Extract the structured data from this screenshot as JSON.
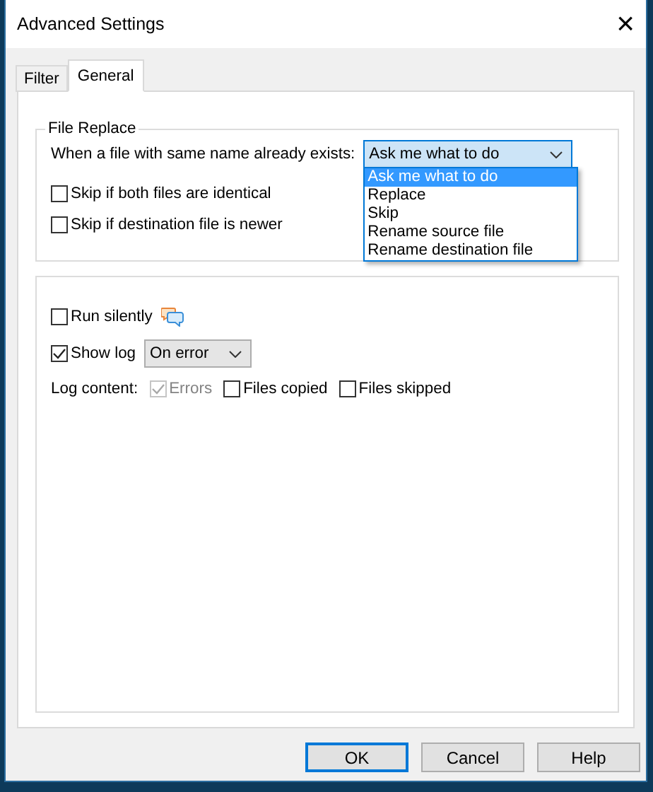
{
  "window": {
    "title": "Advanced Settings",
    "close": "×"
  },
  "tabs": [
    {
      "label": "Filter",
      "selected": false
    },
    {
      "label": "General",
      "selected": true
    }
  ],
  "file_replace": {
    "title": "File Replace",
    "prompt": "When a file with same name already exists:",
    "value": "Ask me what to do",
    "expanded": true,
    "options": [
      {
        "label": "Ask me what to do",
        "selected": true
      },
      {
        "label": "Replace",
        "selected": false
      },
      {
        "label": "Skip",
        "selected": false
      },
      {
        "label": "Rename source file",
        "selected": false
      },
      {
        "label": "Rename destination file",
        "selected": false
      }
    ],
    "checkboxes": [
      {
        "label": "Skip if both files are identical",
        "checked": false
      },
      {
        "label": "Skip if destination file is newer",
        "checked": false
      }
    ]
  },
  "run_silently": {
    "label": "Run silently",
    "checked": false
  },
  "show_log": {
    "label": "Show log",
    "checked": true,
    "value": "On error"
  },
  "log_content": {
    "label": "Log content:",
    "items": [
      {
        "label": "Errors",
        "checked": true,
        "disabled": true
      },
      {
        "label": "Files copied",
        "checked": false,
        "disabled": false
      },
      {
        "label": "Files skipped",
        "checked": false,
        "disabled": false
      }
    ]
  },
  "buttons": [
    {
      "label": "OK",
      "selected": true
    },
    {
      "label": "Cancel",
      "selected": false
    },
    {
      "label": "Help",
      "selected": false
    }
  ]
}
